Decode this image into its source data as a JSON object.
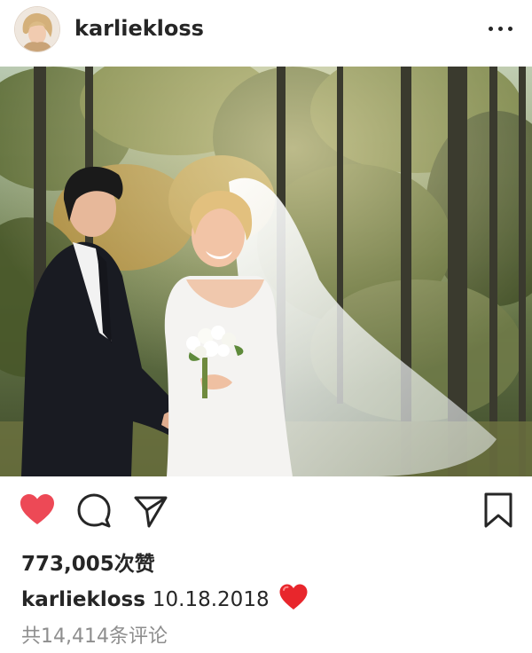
{
  "header": {
    "username": "karliekloss",
    "more_icon": "more-horizontal-icon"
  },
  "post": {
    "image_alt": "wedding photo in forest",
    "caption_user": "karliekloss",
    "caption_text": "10.18.2018",
    "caption_emoji": "red-heart-emoji"
  },
  "actions": {
    "like_icon": "heart-filled-icon",
    "comment_icon": "comment-icon",
    "share_icon": "send-icon",
    "save_icon": "bookmark-icon",
    "liked": true
  },
  "stats": {
    "likes_text": "773,005次赞",
    "comments_text": "共14,414条评论"
  },
  "colors": {
    "like_red": "#ed4956",
    "text": "#262626",
    "muted": "#8e8e8e"
  }
}
